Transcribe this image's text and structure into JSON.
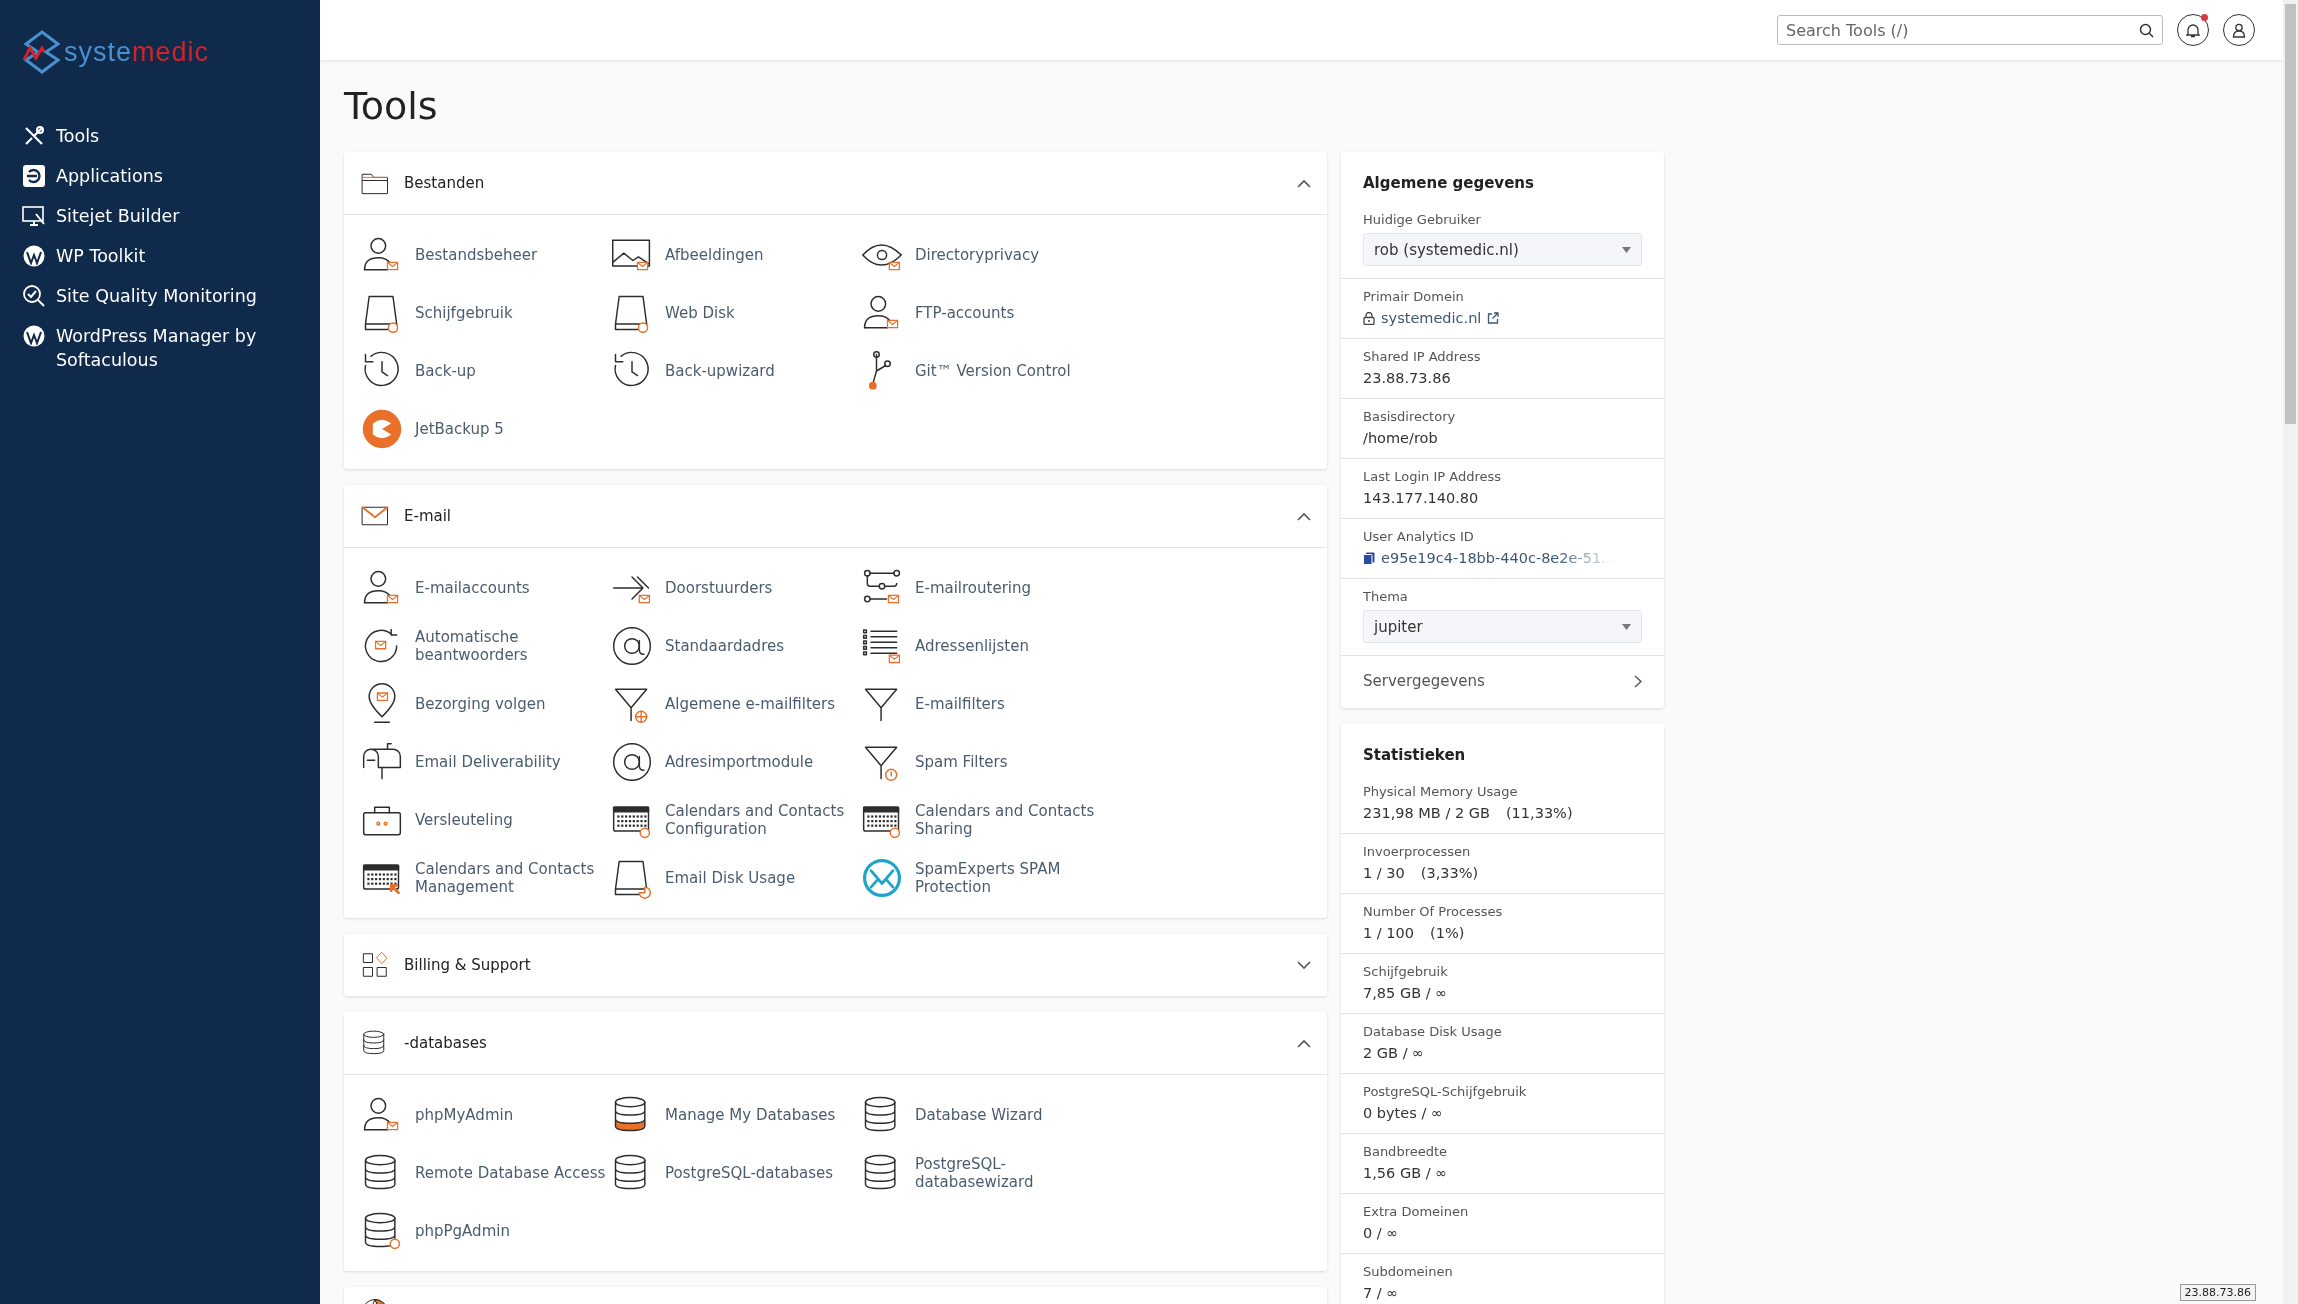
{
  "logo": {
    "parts": [
      {
        "text": "syste",
        "color": "#4a8fd0"
      },
      {
        "text": "medic",
        "color": "#d0232a"
      }
    ]
  },
  "sidebar": {
    "items": [
      {
        "label": "Tools"
      },
      {
        "label": "Applications"
      },
      {
        "label": "Sitejet Builder"
      },
      {
        "label": "WP Toolkit"
      },
      {
        "label": "Site Quality Monitoring"
      },
      {
        "label": "WordPress Manager by Softaculous"
      }
    ]
  },
  "header": {
    "search": {
      "placeholder": "Search Tools (/)"
    },
    "notifications": {
      "unread": true
    }
  },
  "page_title": "Tools",
  "sections": [
    {
      "title": "Bestanden",
      "expanded": true,
      "items": [
        {
          "label": "Bestandsbeheer"
        },
        {
          "label": "Afbeeldingen"
        },
        {
          "label": "Directoryprivacy"
        },
        {
          "label": "Schijfgebruik"
        },
        {
          "label": "Web Disk"
        },
        {
          "label": "FTP-accounts"
        },
        {
          "label": "Back-up"
        },
        {
          "label": "Back-upwizard"
        },
        {
          "label": "Git™ Version Control"
        },
        {
          "label": "JetBackup 5"
        }
      ]
    },
    {
      "title": "E-mail",
      "expanded": true,
      "items": [
        {
          "label": "E-mailaccounts"
        },
        {
          "label": "Doorstuurders"
        },
        {
          "label": "E-mailroutering"
        },
        {
          "label": "Automatische beantwoorders"
        },
        {
          "label": "Standaardadres"
        },
        {
          "label": "Adressenlijsten"
        },
        {
          "label": "Bezorging volgen"
        },
        {
          "label": "Algemene e-mailfilters"
        },
        {
          "label": "E-mailfilters"
        },
        {
          "label": "Email Deliverability"
        },
        {
          "label": "Adresimportmodule"
        },
        {
          "label": "Spam Filters"
        },
        {
          "label": "Versleuteling"
        },
        {
          "label": "Calendars and Contacts Configuration"
        },
        {
          "label": "Calendars and Contacts Sharing"
        },
        {
          "label": "Calendars and Contacts Management"
        },
        {
          "label": "Email Disk Usage"
        },
        {
          "label": "SpamExperts SPAM Protection"
        }
      ]
    },
    {
      "title": "Billing & Support",
      "expanded": false
    },
    {
      "title": "-databases",
      "expanded": true,
      "items": [
        {
          "label": "phpMyAdmin"
        },
        {
          "label": "Manage My Databases"
        },
        {
          "label": "Database Wizard"
        },
        {
          "label": "Remote Database Access"
        },
        {
          "label": "PostgreSQL-databases"
        },
        {
          "label": "PostgreSQL-databasewizard"
        },
        {
          "label": "phpPgAdmin"
        }
      ]
    }
  ],
  "general": {
    "title": "Algemene gegevens",
    "rows": [
      {
        "kind": "select",
        "label": "Huidige Gebruiker",
        "value": "rob (systemedic.nl)"
      },
      {
        "kind": "link",
        "label": "Primair Domein",
        "value": "systemedic.nl"
      },
      {
        "kind": "text",
        "label": "Shared IP Address",
        "value": "23.88.73.86"
      },
      {
        "kind": "text",
        "label": "Basisdirectory",
        "value": "/home/rob"
      },
      {
        "kind": "text",
        "label": "Last Login IP Address",
        "value": "143.177.140.80"
      },
      {
        "kind": "copy",
        "label": "User Analytics ID",
        "value": "e95e19c4-18bb-440c-8e2e-51…"
      },
      {
        "kind": "select",
        "label": "Thema",
        "value": "jupiter"
      },
      {
        "kind": "nav",
        "label": "Servergegevens"
      }
    ]
  },
  "statistics": {
    "title": "Statistieken",
    "rows": [
      {
        "label": "Physical Memory Usage",
        "value": "231,98 MB / 2 GB",
        "percent": "(11,33%)"
      },
      {
        "label": "Invoerprocessen",
        "value": "1 / 30",
        "percent": "(3,33%)"
      },
      {
        "label": "Number Of Processes",
        "value": "1 / 100",
        "percent": "(1%)"
      },
      {
        "label": "Schijfgebruik",
        "value": "7,85 GB / ∞"
      },
      {
        "label": "Database Disk Usage",
        "value": "2 GB / ∞"
      },
      {
        "label": "PostgreSQL-Schijfgebruik",
        "value": "0 bytes / ∞"
      },
      {
        "label": "Bandbreedte",
        "value": "1,56 GB / ∞"
      },
      {
        "label": "Extra Domeinen",
        "value": "0 / ∞"
      },
      {
        "label": "Subdomeinen",
        "value": "7 / ∞"
      }
    ]
  },
  "ip_badge": "23.88.73.86"
}
